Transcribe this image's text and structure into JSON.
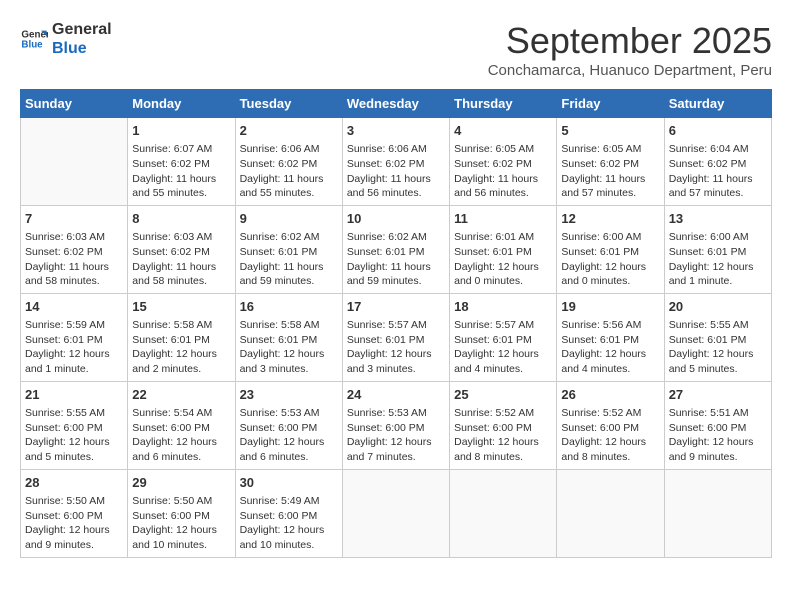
{
  "logo": {
    "line1": "General",
    "line2": "Blue"
  },
  "title": "September 2025",
  "subtitle": "Conchamarca, Huanuco Department, Peru",
  "weekdays": [
    "Sunday",
    "Monday",
    "Tuesday",
    "Wednesday",
    "Thursday",
    "Friday",
    "Saturday"
  ],
  "weeks": [
    [
      {
        "day": "",
        "info": ""
      },
      {
        "day": "1",
        "info": "Sunrise: 6:07 AM\nSunset: 6:02 PM\nDaylight: 11 hours\nand 55 minutes."
      },
      {
        "day": "2",
        "info": "Sunrise: 6:06 AM\nSunset: 6:02 PM\nDaylight: 11 hours\nand 55 minutes."
      },
      {
        "day": "3",
        "info": "Sunrise: 6:06 AM\nSunset: 6:02 PM\nDaylight: 11 hours\nand 56 minutes."
      },
      {
        "day": "4",
        "info": "Sunrise: 6:05 AM\nSunset: 6:02 PM\nDaylight: 11 hours\nand 56 minutes."
      },
      {
        "day": "5",
        "info": "Sunrise: 6:05 AM\nSunset: 6:02 PM\nDaylight: 11 hours\nand 57 minutes."
      },
      {
        "day": "6",
        "info": "Sunrise: 6:04 AM\nSunset: 6:02 PM\nDaylight: 11 hours\nand 57 minutes."
      }
    ],
    [
      {
        "day": "7",
        "info": "Sunrise: 6:03 AM\nSunset: 6:02 PM\nDaylight: 11 hours\nand 58 minutes."
      },
      {
        "day": "8",
        "info": "Sunrise: 6:03 AM\nSunset: 6:02 PM\nDaylight: 11 hours\nand 58 minutes."
      },
      {
        "day": "9",
        "info": "Sunrise: 6:02 AM\nSunset: 6:01 PM\nDaylight: 11 hours\nand 59 minutes."
      },
      {
        "day": "10",
        "info": "Sunrise: 6:02 AM\nSunset: 6:01 PM\nDaylight: 11 hours\nand 59 minutes."
      },
      {
        "day": "11",
        "info": "Sunrise: 6:01 AM\nSunset: 6:01 PM\nDaylight: 12 hours\nand 0 minutes."
      },
      {
        "day": "12",
        "info": "Sunrise: 6:00 AM\nSunset: 6:01 PM\nDaylight: 12 hours\nand 0 minutes."
      },
      {
        "day": "13",
        "info": "Sunrise: 6:00 AM\nSunset: 6:01 PM\nDaylight: 12 hours\nand 1 minute."
      }
    ],
    [
      {
        "day": "14",
        "info": "Sunrise: 5:59 AM\nSunset: 6:01 PM\nDaylight: 12 hours\nand 1 minute."
      },
      {
        "day": "15",
        "info": "Sunrise: 5:58 AM\nSunset: 6:01 PM\nDaylight: 12 hours\nand 2 minutes."
      },
      {
        "day": "16",
        "info": "Sunrise: 5:58 AM\nSunset: 6:01 PM\nDaylight: 12 hours\nand 3 minutes."
      },
      {
        "day": "17",
        "info": "Sunrise: 5:57 AM\nSunset: 6:01 PM\nDaylight: 12 hours\nand 3 minutes."
      },
      {
        "day": "18",
        "info": "Sunrise: 5:57 AM\nSunset: 6:01 PM\nDaylight: 12 hours\nand 4 minutes."
      },
      {
        "day": "19",
        "info": "Sunrise: 5:56 AM\nSunset: 6:01 PM\nDaylight: 12 hours\nand 4 minutes."
      },
      {
        "day": "20",
        "info": "Sunrise: 5:55 AM\nSunset: 6:01 PM\nDaylight: 12 hours\nand 5 minutes."
      }
    ],
    [
      {
        "day": "21",
        "info": "Sunrise: 5:55 AM\nSunset: 6:00 PM\nDaylight: 12 hours\nand 5 minutes."
      },
      {
        "day": "22",
        "info": "Sunrise: 5:54 AM\nSunset: 6:00 PM\nDaylight: 12 hours\nand 6 minutes."
      },
      {
        "day": "23",
        "info": "Sunrise: 5:53 AM\nSunset: 6:00 PM\nDaylight: 12 hours\nand 6 minutes."
      },
      {
        "day": "24",
        "info": "Sunrise: 5:53 AM\nSunset: 6:00 PM\nDaylight: 12 hours\nand 7 minutes."
      },
      {
        "day": "25",
        "info": "Sunrise: 5:52 AM\nSunset: 6:00 PM\nDaylight: 12 hours\nand 8 minutes."
      },
      {
        "day": "26",
        "info": "Sunrise: 5:52 AM\nSunset: 6:00 PM\nDaylight: 12 hours\nand 8 minutes."
      },
      {
        "day": "27",
        "info": "Sunrise: 5:51 AM\nSunset: 6:00 PM\nDaylight: 12 hours\nand 9 minutes."
      }
    ],
    [
      {
        "day": "28",
        "info": "Sunrise: 5:50 AM\nSunset: 6:00 PM\nDaylight: 12 hours\nand 9 minutes."
      },
      {
        "day": "29",
        "info": "Sunrise: 5:50 AM\nSunset: 6:00 PM\nDaylight: 12 hours\nand 10 minutes."
      },
      {
        "day": "30",
        "info": "Sunrise: 5:49 AM\nSunset: 6:00 PM\nDaylight: 12 hours\nand 10 minutes."
      },
      {
        "day": "",
        "info": ""
      },
      {
        "day": "",
        "info": ""
      },
      {
        "day": "",
        "info": ""
      },
      {
        "day": "",
        "info": ""
      }
    ]
  ]
}
